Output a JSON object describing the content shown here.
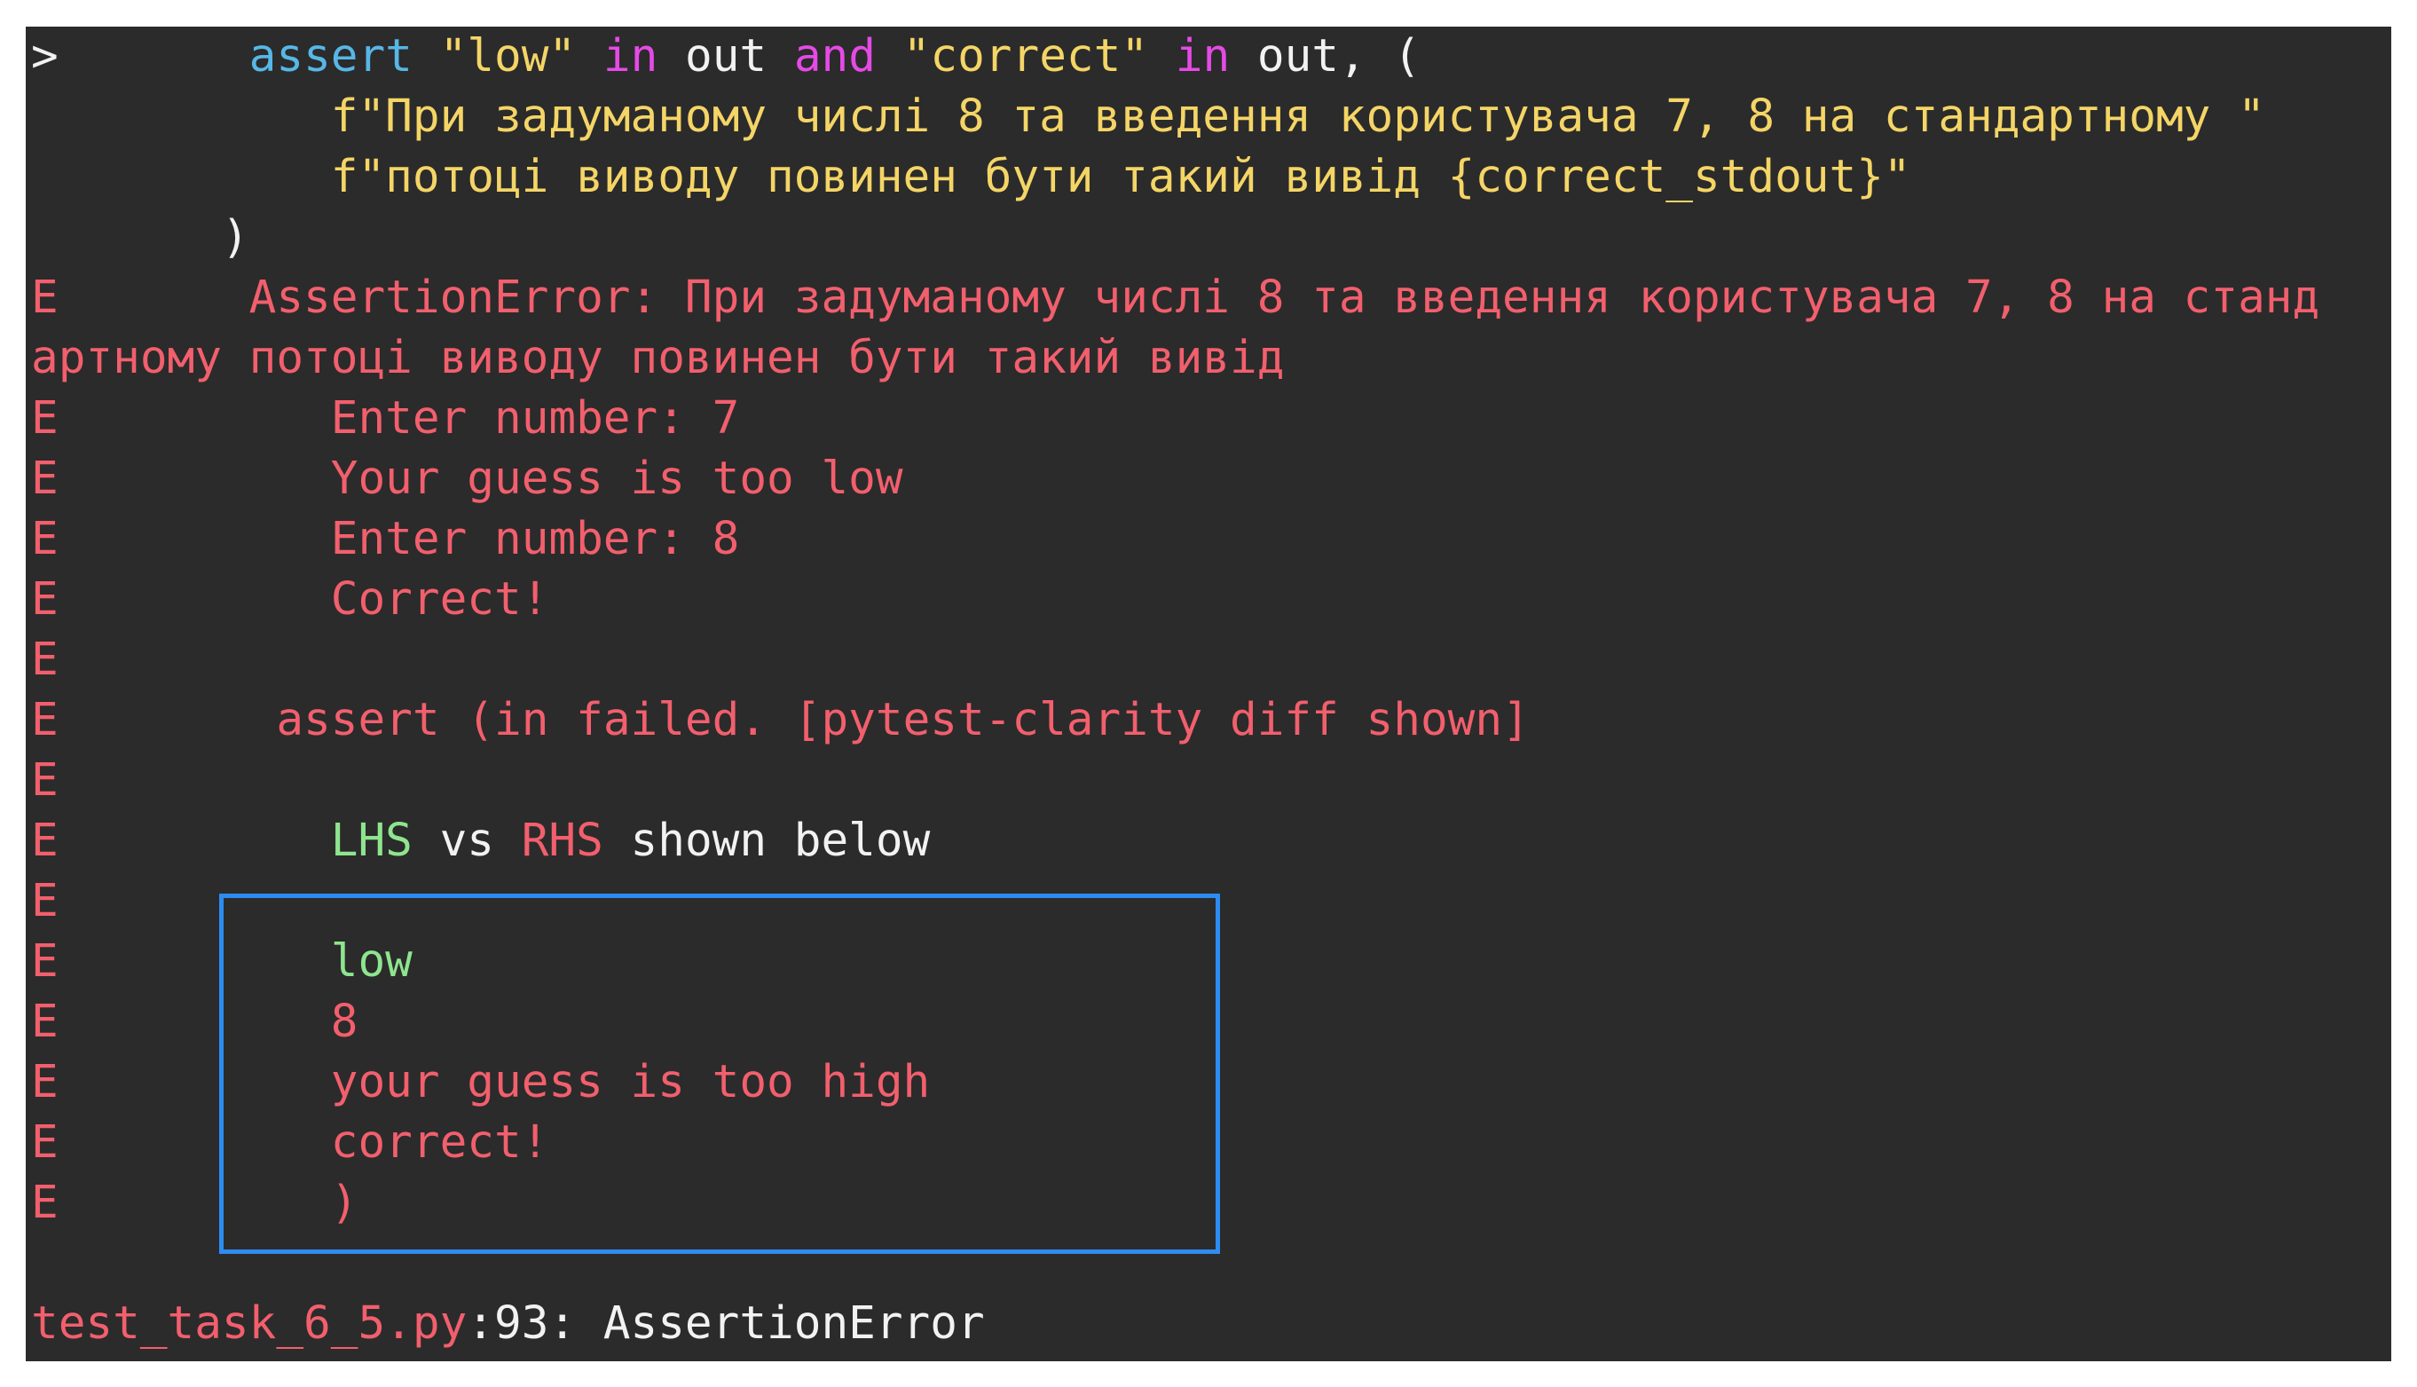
{
  "source_lines": {
    "l1": {
      "marker": ">",
      "indent": "       ",
      "kw_assert": "assert",
      "s1": "\"low\"",
      "kw_in1": "in",
      "out1": "out",
      "kw_and": "and",
      "s2": "\"correct\"",
      "kw_in2": "in",
      "tail": "out, ("
    },
    "l2": "           f\"При задуманому числі 8 та введення користувача 7, 8 на стандартному \"",
    "l3": "           f\"потоці виводу повинен бути такий вивід {correct_stdout}\"",
    "l4": "       )"
  },
  "error": {
    "marker": "E",
    "line1": "       AssertionError: При задуманому числі 8 та введення користувача 7, 8 на станд",
    "line2": "артному потоці виводу повинен бути такий вивід",
    "stdout": [
      "Enter number: 7",
      "Your guess is too low",
      "Enter number: 8",
      "Correct!"
    ],
    "clarity": "assert (in failed. [pytest-clarity diff shown]",
    "lhs_label": "LHS",
    "vs_label": " vs ",
    "rhs_label": "RHS",
    "shown_below": " shown below",
    "diff": [
      "low",
      "8",
      "your guess is too high",
      "correct!",
      ")"
    ]
  },
  "footer": {
    "file": "test_task_6_5.py",
    "location": ":93: AssertionError"
  },
  "colors": {
    "background": "#2b2b2b",
    "error_red": "#f25f6d",
    "string_yellow": "#f4d566",
    "keyword_cyan": "#57b7e6",
    "keyword_magenta": "#e64ae6",
    "lhs_green": "#8ee58e",
    "highlight_box_blue": "#2e8cf0"
  }
}
